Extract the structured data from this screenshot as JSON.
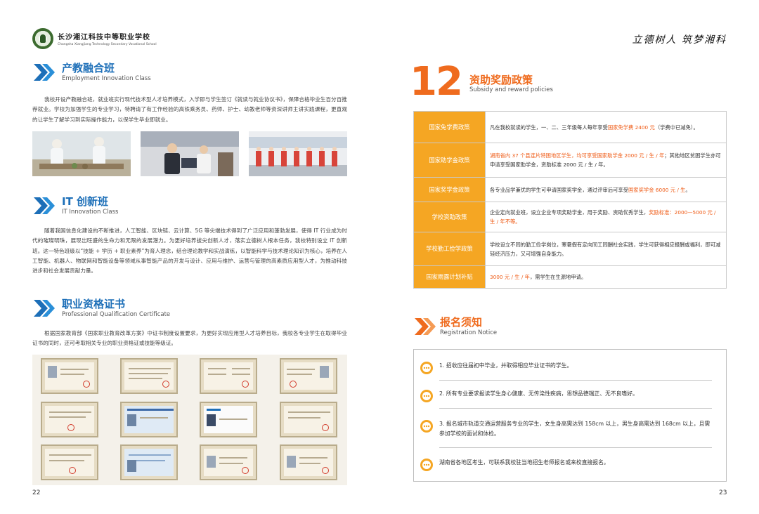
{
  "header": {
    "school_cn": "长沙湘江科技中等职业学校",
    "school_en": "Changsha Xiangjiang Technology Secondary Vocational School",
    "motto": "立德树人 筑梦湘科"
  },
  "left": {
    "sections": [
      {
        "title_cn": "产教融合班",
        "title_en": "Employment Innovation Class",
        "text": "我校开设产教融合班，就业班实行现代技术型人才培养模式，入学即与学生签订《就读与就业协议书》，保障合格毕业生百分百推荐就业。学校为加强学生的专业学习，特聘请了有工作经验的高铁乘务员、药师、护士、幼教老师等资深讲师主讲实践课程，更直观的让学生了解学习到实际操作能力，以保学生毕业即就业。"
      },
      {
        "title_cn": "IT 创新班",
        "title_en": "IT Innovation Class",
        "text": "随着我国信息化建设的不断推进，人工智能、区块链、云计算、5G 等尖端技术得到了广泛应用和蓬勃发展，使得 IT 行业成为时代的璀璨明珠，展现出旺盛的生命力和无限的发展潜力。为更好培养拔尖创新人才，落实立德树人根本任务，我校特别设立 IT 创新班。这一特色班级以“技能 + 学历 + 职业素养”为育人理念，结合理论教学和实战演练，以智能科学与技术理论知识为核心，培养在人工智能、机器人、物联网和智能设备等领域从事智能产品的开发与设计、应用与维护、运营与管理的高素质应用型人才，为推动科技进步和社会发展贡献力量。"
      },
      {
        "title_cn": "职业资格证书",
        "title_en": "Professional Qualification Certificate",
        "text": "根据国家教育部《国家职业教育改革方案》中证书制度设置要求，为更好实现应用型人才培养目标，我校各专业学生在取得毕业证书的同时，还可考取相关专业的职业资格证或技能等级证。"
      }
    ],
    "page_number": "22"
  },
  "right": {
    "number": "12",
    "title_cn": "资助奖励政策",
    "title_en": "Subsidy and reward policies",
    "policies": [
      {
        "key": "国家免学费政策",
        "parts": [
          {
            "t": "凡在我校就读的学生，一、二、三年级每人每年享受"
          },
          {
            "t": "国家免学费 2400 元",
            "hl": true
          },
          {
            "t": "（学费中已减免）。"
          }
        ]
      },
      {
        "key": "国家助学金政策",
        "parts": [
          {
            "t": "湖南省内 37 个县连片特困地区学生，均可享受国家助学金 2000 元 / 生 / 年",
            "hl": true
          },
          {
            "t": "；其他地区贫困学生亦可申请享受国家助学金，资助标准 2000 元 / 生 / 年。"
          }
        ]
      },
      {
        "key": "国家奖学金政策",
        "parts": [
          {
            "t": "各专业品学兼优的学生可申请国家奖学金，通过评审后可享受"
          },
          {
            "t": "国家奖学金 6000 元 / 生",
            "hl": true
          },
          {
            "t": "。"
          }
        ]
      },
      {
        "key": "学校资助政策",
        "parts": [
          {
            "t": "企业定向就业班，设立企业专项奖助学金，用于奖励、资助优秀学生，"
          },
          {
            "t": "奖励标准：2000—5000 元 / 生 / 年不等。",
            "hl": true
          }
        ]
      },
      {
        "key": "学校勤工俭学政策",
        "parts": [
          {
            "t": "学校设立不同的勤工俭学岗位，寒暑假有定向同工同酬社会实践，学生可获得相应报酬或福利，即可减轻经济压力，又可增强自身能力。"
          }
        ]
      },
      {
        "key": "国家雨露计划补贴",
        "parts": [
          {
            "t": "3000 元 / 生 / 年",
            "hl": true
          },
          {
            "t": "，需学生在生源地申请。"
          }
        ]
      }
    ],
    "registration": {
      "title_cn": "报名须知",
      "title_en": "Registration Notice",
      "items": [
        "1. 招收应往届初中毕业，并取得相应毕业证书的学生。",
        "2. 所有专业要求报读学生身心健康、无传染性疾病，思想品德端正、无不良嗜好。",
        "3. 报名城市轨道交通运营服务专业的学生，女生身高需达到 158cm 以上，男生身高需达到 168cm 以上，且需参加学校的面试和体检。",
        "湖南省各地区考生，可联系我校驻当地招生老师报名或来校直接报名。"
      ]
    },
    "page_number": "23"
  },
  "colors": {
    "blue": "#1d6fb8",
    "orange": "#ef6b1e",
    "amber": "#f5a623"
  }
}
